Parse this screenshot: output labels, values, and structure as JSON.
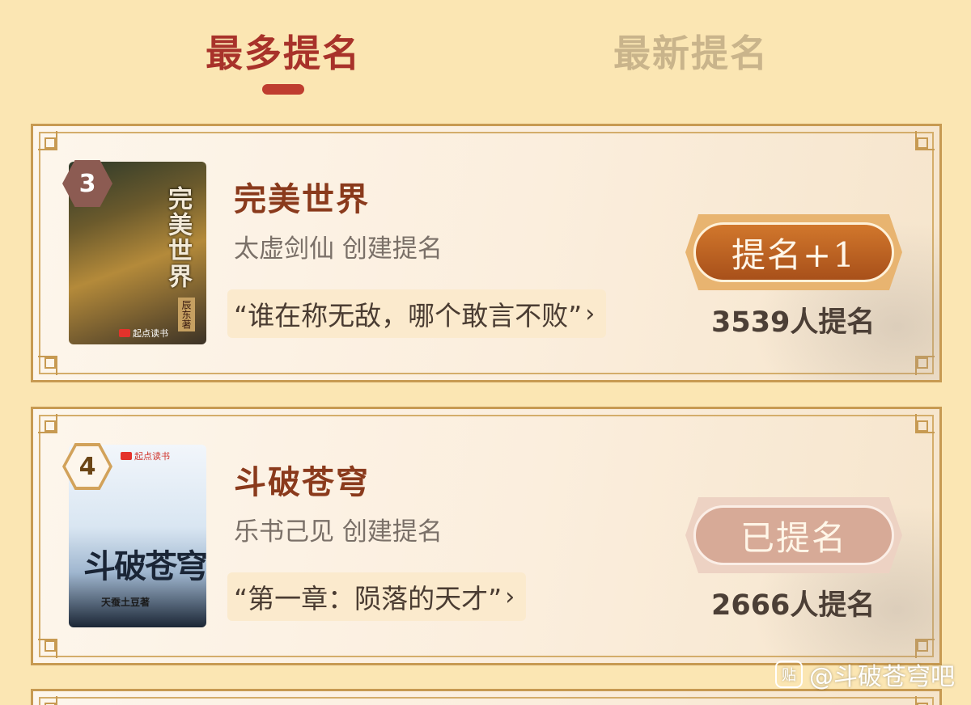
{
  "tabs": {
    "active_label": "最多提名",
    "inactive_label": "最新提名"
  },
  "books": [
    {
      "rank": "3",
      "title": "完美世界",
      "creator": "太虚剑仙 创建提名",
      "quote": "“谁在称无敌，哪个敢言不败”",
      "button_label": "提名+1",
      "count": "3539人提名",
      "cover": {
        "title": "完美世界",
        "author": "辰东著",
        "brand": "起点读书"
      }
    },
    {
      "rank": "4",
      "title": "斗破苍穹",
      "creator": "乐书己见 创建提名",
      "quote": "“第一章：陨落的天才”",
      "button_label": "已提名",
      "count": "2666人提名",
      "cover": {
        "title": "斗破苍穹",
        "author": "天蚕土豆著",
        "brand": "起点读书"
      }
    }
  ],
  "watermark": "@斗破苍穹吧",
  "watermark_icon": "贴",
  "colors": {
    "background": "#fbe6b3",
    "tab_active": "#a8322a",
    "tab_inactive": "#c9b48b",
    "title": "#8a3a1c",
    "button_active": "#c0622a",
    "button_done": "#d7aa97"
  }
}
